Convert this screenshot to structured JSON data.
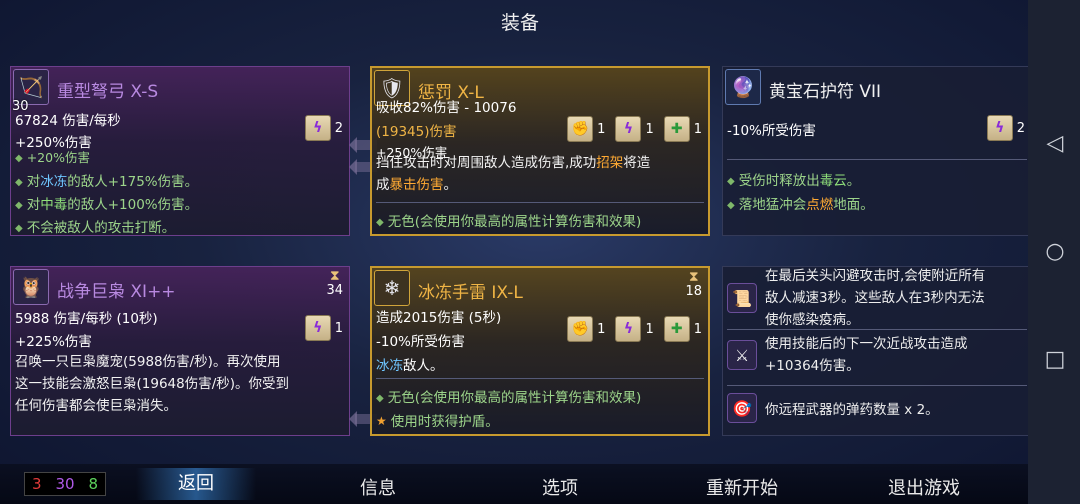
{
  "title": "装备",
  "cards": {
    "crossbow": {
      "name": "重型弩弓 X-S",
      "level": "30",
      "dps": "67824 伤害/每秒",
      "bonus": "+250%伤害",
      "scroll_count": "2",
      "b0": "+20%伤害",
      "b1_pre": "对",
      "b1_kw": "冰冻",
      "b1_post": "的敌人+175%伤害。",
      "b2_pre": "对",
      "b2_kw": "中毒",
      "b2_post": "的敌人+100%伤害。",
      "b3": "不会被敌人的攻击打断。"
    },
    "punish": {
      "name": "惩罚 X-L",
      "stat1": "吸收82%伤害 - 10076",
      "stat2": "(19345)伤害",
      "stat3": "+250%伤害",
      "s1": "1",
      "s2": "1",
      "s3": "1",
      "desc_a": "挡住攻击时对周围敌人造成伤害,成功",
      "desc_kw1": "招架",
      "desc_b": "将造",
      "desc_c": "成",
      "desc_kw2": "暴击伤害",
      "desc_d": "。",
      "bullet": "无色(会使用你最高的属性计算伤害和效果)"
    },
    "amulet": {
      "name": "黄宝石护符 VII",
      "stat": "-10%所受伤害",
      "scroll_count": "2",
      "b1_pre": "受伤时释放出",
      "b1_kw": "毒云",
      "b1_post": "。",
      "b2_pre": "落地猛冲会",
      "b2_kw": "点燃",
      "b2_post": "地面。"
    },
    "owl": {
      "name": "战争巨枭 XI++",
      "cooldown": "34",
      "dps": "5988 伤害/每秒 (10秒)",
      "bonus": "+225%伤害",
      "scroll_count": "1",
      "d1": "召唤一只巨枭魔宠(5988伤害/秒)。再次使用",
      "d2": "这一技能会激怒巨枭(19648伤害/秒)。你受到",
      "d3": "任何伤害都会使巨枭消失。"
    },
    "grenade": {
      "name": "冰冻手雷 IX-L",
      "cooldown": "18",
      "stat1": "造成2015伤害 (5秒)",
      "stat2": "-10%所受伤害",
      "s1": "1",
      "s2": "1",
      "s3": "1",
      "d_kw": "冰冻",
      "d_post": "敌人。",
      "bullet1": "无色(会使用你最高的属性计算伤害和效果)",
      "bullet2": "使用时获得护盾。"
    }
  },
  "mutations": {
    "m1_l1": "在最后关头闪避攻击时,会使附近所有",
    "m1_l2": "敌人减速3秒。这些敌人在3秒内无法",
    "m1_l3": "使你感染疫病。",
    "m2_l1": "使用技能后的下一次近战攻击造成",
    "m2_l2": "+10364伤害。",
    "m3": "你远程武器的弹药数量 x 2。"
  },
  "resources": {
    "red": "3",
    "purple": "30",
    "green": "8"
  },
  "menu": {
    "back": "返回",
    "info": "信息",
    "options": "选项",
    "restart": "重新开始",
    "quit": "退出游戏"
  },
  "colors": {
    "purple_stat": "#b889e0",
    "gold_stat": "#f0b545",
    "red": "#e03a3a",
    "purple": "#b05ae8",
    "green": "#5cd35c"
  }
}
